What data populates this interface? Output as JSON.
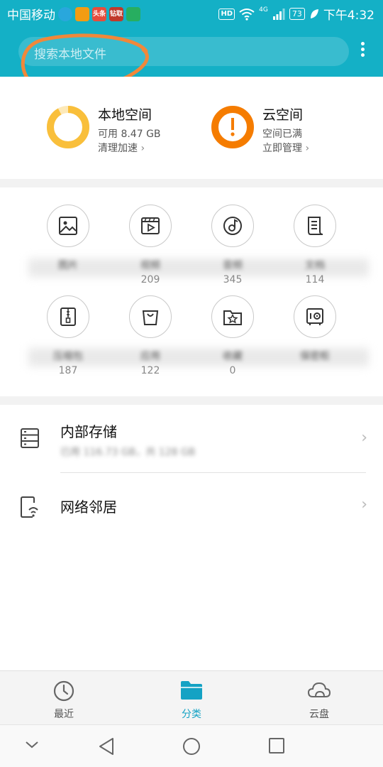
{
  "status_bar": {
    "carrier": "中国移动",
    "apps": [
      {
        "label": "",
        "color": "#29a7dc"
      },
      {
        "label": "",
        "color": "#f39c12"
      },
      {
        "label": "头条",
        "color": "#e74c3c"
      },
      {
        "label": "钻取",
        "color": "#c0392b"
      },
      {
        "label": "",
        "color": "#27ae60"
      }
    ],
    "hd": "HD",
    "network": "4G",
    "battery": "73",
    "time": "下午4:32"
  },
  "search": {
    "placeholder": "搜索本地文件"
  },
  "storage": {
    "local": {
      "title": "本地空间",
      "available": "可用 8.47 GB",
      "action": "清理加速",
      "ring_percent": 0.92
    },
    "cloud": {
      "title": "云空间",
      "status": "空间已满",
      "action": "立即管理"
    }
  },
  "categories": [
    {
      "name": "图片",
      "count": "",
      "icon": "image-icon"
    },
    {
      "name": "视频",
      "count": "209",
      "icon": "video-icon"
    },
    {
      "name": "音频",
      "count": "345",
      "icon": "music-icon"
    },
    {
      "name": "文档",
      "count": "114",
      "icon": "document-icon"
    },
    {
      "name": "压缩包",
      "count": "187",
      "icon": "zip-icon"
    },
    {
      "name": "应用",
      "count": "122",
      "icon": "app-bag-icon"
    },
    {
      "name": "收藏",
      "count": "0",
      "icon": "star-folder-icon"
    },
    {
      "name": "保密柜",
      "count": "",
      "icon": "safe-icon"
    }
  ],
  "locations": [
    {
      "title": "内部存储",
      "subtitle": "已用 116.73 GB，共 128 GB",
      "icon": "storage-icon"
    },
    {
      "title": "网络邻居",
      "subtitle": "",
      "icon": "network-neighbor-icon"
    }
  ],
  "bottom_nav": [
    {
      "label": "最近",
      "icon": "clock-icon",
      "active": false
    },
    {
      "label": "分类",
      "icon": "folder-icon",
      "active": true
    },
    {
      "label": "云盘",
      "icon": "cloud-icon",
      "active": false
    }
  ],
  "colors": {
    "accent": "#14b0c6",
    "local_ring": "#f9bf3b",
    "cloud_ring": "#f57c00",
    "active_tab": "#14a2c4"
  }
}
